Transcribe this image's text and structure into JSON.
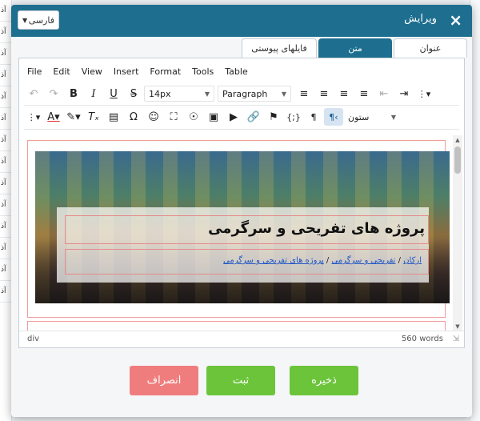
{
  "background": {
    "left_rows": [
      "آذ",
      "آذ",
      "آذ",
      "آذ",
      "آذ",
      "آذ",
      "آذ",
      "آذ",
      "آذ",
      "آذ",
      "آذ",
      "آذ",
      "آذ",
      "آذ"
    ],
    "right_rows": [
      "",
      "",
      "",
      "",
      "",
      "",
      "",
      "",
      "",
      "",
      "",
      "",
      "",
      ""
    ]
  },
  "modal": {
    "title": "ویرایش",
    "close_icon": "×",
    "language": "فارسی",
    "tabs": [
      {
        "label": "عنوان",
        "active": false
      },
      {
        "label": "متن",
        "active": true
      },
      {
        "label": "فایلهای پیوستی",
        "active": false
      }
    ]
  },
  "editor": {
    "menu": [
      "File",
      "Edit",
      "View",
      "Insert",
      "Format",
      "Tools",
      "Table"
    ],
    "font_size": "14px",
    "block_format": "Paragraph",
    "columns_label": "ستون",
    "content": {
      "page_title": "پروژه های تفریحی و سرگرمی",
      "breadcrumb": {
        "home": "ارکان",
        "separator": "/",
        "crumb1": "تفریحی و سرگرمی",
        "crumb2": "پروژه های تفریحی و سرگرمی"
      }
    },
    "status": {
      "path": "div",
      "words": "560 words"
    }
  },
  "buttons": {
    "save": "ذخیره",
    "submit": "ثبت",
    "cancel": "انصراف"
  },
  "colors": {
    "header": "#1d6e8f",
    "save": "#6cc43b",
    "cancel": "#f07d7d",
    "link": "#1f56c5"
  }
}
